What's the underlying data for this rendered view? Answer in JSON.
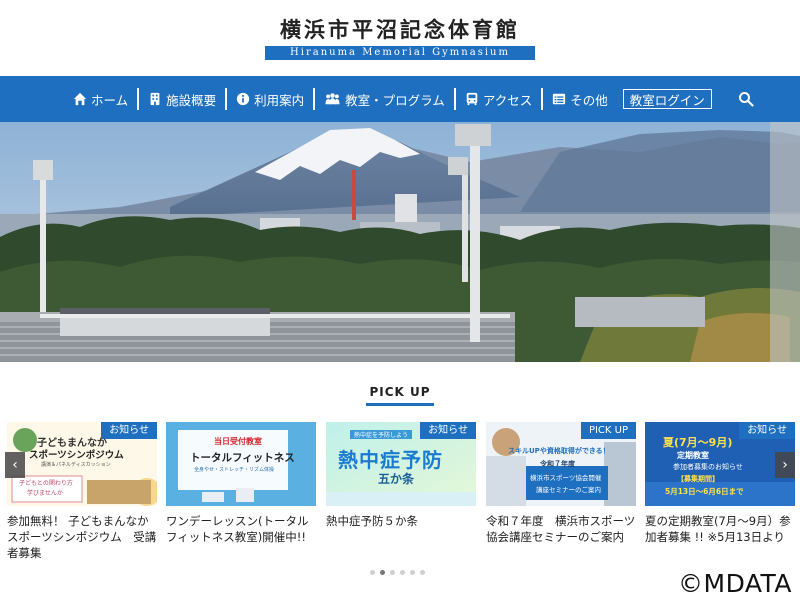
{
  "header": {
    "title_jp": "横浜市平沼記念体育館",
    "title_en": "Hiranuma Memorial Gymnasium"
  },
  "nav": {
    "items": [
      {
        "label": "ホーム",
        "icon": "home-icon"
      },
      {
        "label": "施設概要",
        "icon": "building-icon"
      },
      {
        "label": "利用案内",
        "icon": "info-icon"
      },
      {
        "label": "教室・プログラム",
        "icon": "people-icon"
      },
      {
        "label": "アクセス",
        "icon": "bus-icon"
      },
      {
        "label": "その他",
        "icon": "list-icon"
      }
    ],
    "login_label": "教室ログイン",
    "search_icon": "search-icon"
  },
  "pickup": {
    "title": "PICK UP",
    "cards": [
      {
        "badge": "お知らせ",
        "title": "参加無料！ 子どもまんなかスポーツシンポジウム　受講者募集",
        "image_text": [
          "子どもまんなか",
          "スポーツシンポジウム",
          "講演＆パネルディスカッション",
          "子どもとの関わり方",
          "学びませんか"
        ]
      },
      {
        "badge": "お知らせ",
        "title": "ワンデーレッスン(トータルフィットネス教室)開催中!!",
        "image_text": [
          "当日受付教室",
          "トータルフィットネス",
          "全身やせ・ストレッチ・リズム体操"
        ]
      },
      {
        "badge": "お知らせ",
        "title": "熱中症予防５か条",
        "image_text": [
          "熱中症を予防しよう",
          "熱中症予防",
          "五か条"
        ]
      },
      {
        "badge": "PICK UP",
        "title": "令和７年度　横浜市スポーツ協会講座セミナーのご案内",
        "image_text": [
          "スキルUPや資格取得ができる！",
          "令和７年度",
          "横浜市スポーツ協会開催",
          "講座セミナーのご案内"
        ]
      },
      {
        "badge": "お知らせ",
        "title": "夏の定期教室(7月～9月）参加者募集 !! ※5月13日より",
        "image_text": [
          "夏(7月～9月)",
          "定期教室",
          "参加者募集のお知らせ",
          "【募集期間】",
          "5月13日～6月6日まで"
        ]
      }
    ],
    "dots_count": 6,
    "active_dot": 2
  },
  "controls": {
    "prev_arrow": "‹",
    "next_arrow": "›"
  },
  "watermark": "©MDATA",
  "colors": {
    "brand": "#1e6fc0",
    "badge": "#1e6fc0"
  }
}
